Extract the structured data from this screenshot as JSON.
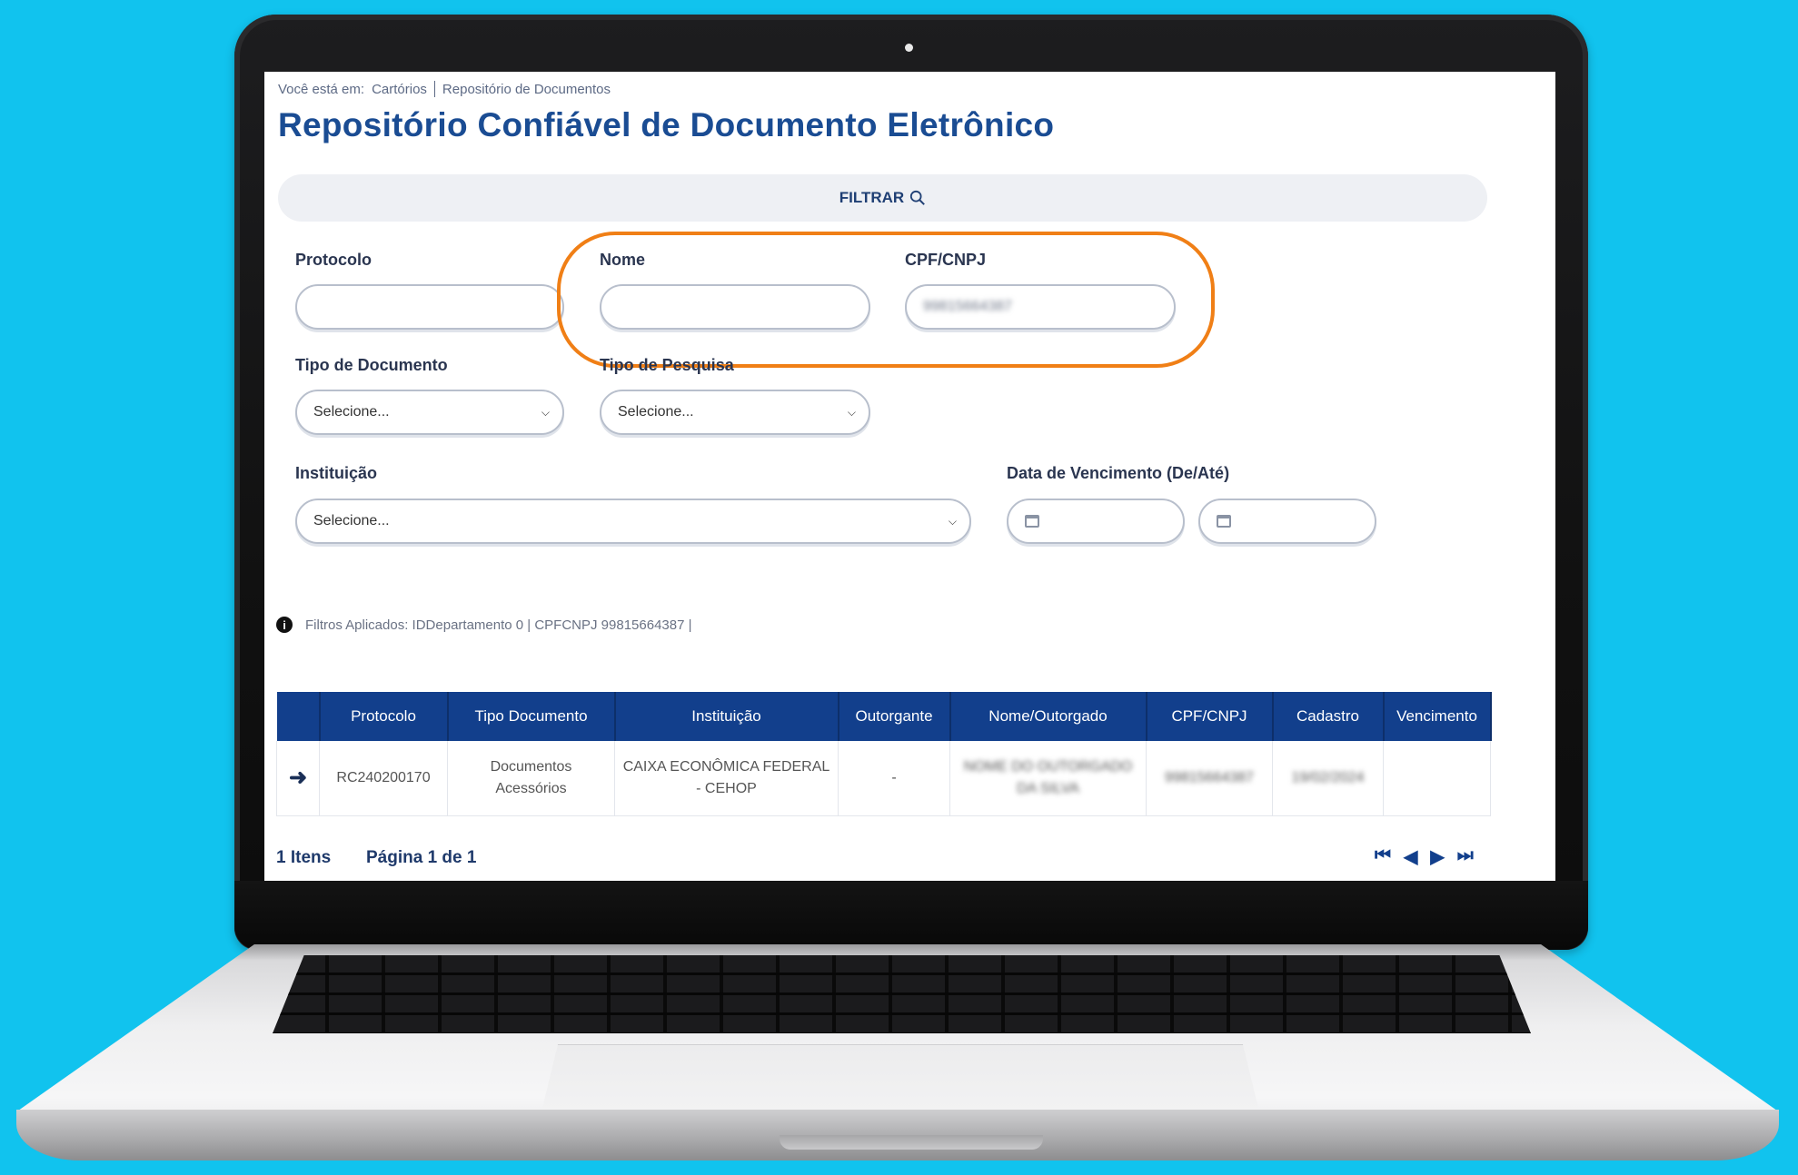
{
  "breadcrumb": {
    "prefix": "Você está em:",
    "items": [
      "Cartórios",
      "Repositório de Documentos"
    ]
  },
  "page_title": "Repositório Confiável de Documento Eletrônico",
  "filter_bar": {
    "label": "FILTRAR",
    "icon": "search-icon"
  },
  "form": {
    "protocolo": {
      "label": "Protocolo",
      "value": ""
    },
    "nome": {
      "label": "Nome",
      "value": ""
    },
    "cpf_cnpj": {
      "label": "CPF/CNPJ",
      "value": "99815664387"
    },
    "tipo_documento": {
      "label": "Tipo de Documento",
      "selected": "Selecione..."
    },
    "tipo_pesquisa": {
      "label": "Tipo de Pesquisa",
      "selected": "Selecione..."
    },
    "instituicao": {
      "label": "Instituição",
      "selected": "Selecione..."
    },
    "data_vencimento": {
      "label": "Data de Vencimento (De/Até)",
      "from": "",
      "to": ""
    }
  },
  "highlight_color": "#f07f16",
  "applied_filters": "Filtros Aplicados: IDDepartamento 0 | CPFCNPJ 99815664387 |",
  "table": {
    "headers": [
      "",
      "Protocolo",
      "Tipo Documento",
      "Instituição",
      "Outorgante",
      "Nome/Outorgado",
      "CPF/CNPJ",
      "Cadastro",
      "Vencimento"
    ],
    "rows": [
      {
        "protocolo": "RC240200170",
        "tipo_documento": "Documentos Acessórios",
        "instituicao": "CAIXA ECONÔMICA FEDERAL - CEHOP",
        "outorgante": "-",
        "nome_outorgado": "NOME DO OUTORGADO DA SILVA",
        "cpf_cnpj": "99815664387",
        "cadastro": "19/02/2024",
        "vencimento": ""
      }
    ]
  },
  "footer": {
    "count": "1 Itens",
    "page": "Página 1 de 1",
    "pager_icons": [
      "first-page-icon",
      "prev-page-icon",
      "next-page-icon",
      "last-page-icon"
    ]
  },
  "colors": {
    "background": "#11c3ee",
    "title": "#1a4c93",
    "table_header": "#123f8c"
  }
}
